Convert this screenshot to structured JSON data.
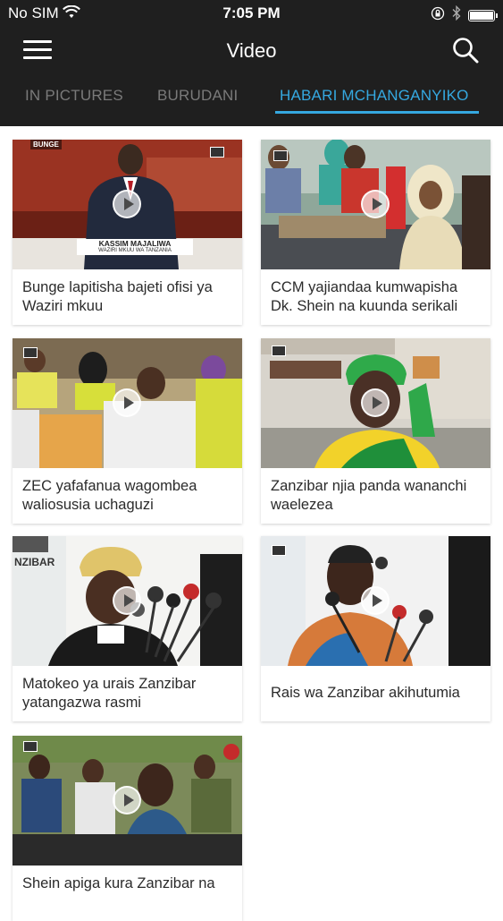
{
  "status_bar": {
    "carrier": "No SIM",
    "time": "7:05 PM",
    "battery_level": 1.0,
    "icons": [
      "wifi-icon",
      "orientation-lock-icon",
      "bluetooth-icon",
      "battery-icon"
    ]
  },
  "nav": {
    "title": "Video",
    "menu_icon": "hamburger-menu-icon",
    "search_icon": "search-icon"
  },
  "tabs": [
    {
      "label": "IN PICTURES",
      "active": false
    },
    {
      "label": "BURUDANI",
      "active": false
    },
    {
      "label": "HABARI MCHANGANYIKO",
      "active": true
    }
  ],
  "colors": {
    "header_bg": "#1f1f1f",
    "tab_active": "#35a8e0",
    "tab_inactive": "#7a7a7a",
    "caption_text": "#2b2b2b"
  },
  "videos": [
    {
      "caption": "Bunge lapitisha bajeti ofisi ya Waziri mkuu",
      "thumb_badge": "BUNGE",
      "lower_third_name": "KASSIM MAJALIWA",
      "lower_third_title": "WAZIRI MKUU WA TANZANIA"
    },
    {
      "caption": "CCM yajiandaa kumwapisha Dk. Shein na kuunda serikali"
    },
    {
      "caption": "ZEC yafafanua wagombea waliosusia uchaguzi"
    },
    {
      "caption": "Zanzibar njia panda wananchi waelezea"
    },
    {
      "caption": "Matokeo ya urais Zanzibar yatangazwa rasmi",
      "thumb_text": "NZIBAR"
    },
    {
      "caption": "Rais wa Zanzibar akihutumia"
    },
    {
      "caption": "Shein apiga kura Zanzibar na"
    }
  ]
}
